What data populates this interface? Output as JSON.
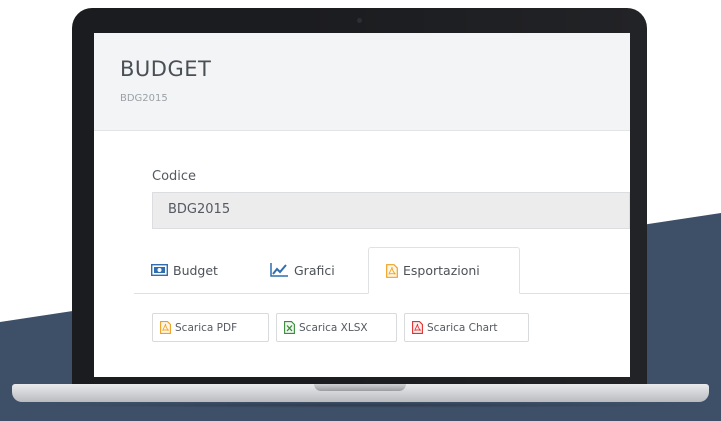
{
  "header": {
    "title": "BUDGET",
    "subtitle": "BDG2015"
  },
  "form": {
    "codice_label": "Codice",
    "codice_value": "BDG2015"
  },
  "tabs": [
    {
      "label": "Budget",
      "icon": "money-icon",
      "active": false
    },
    {
      "label": "Grafici",
      "icon": "line-chart-icon",
      "active": false
    },
    {
      "label": "Esportazioni",
      "icon": "file-pdf-icon",
      "active": true
    }
  ],
  "buttons": {
    "pdf": "Scarica PDF",
    "xlsx": "Scarica XLSX",
    "chart": "Scarica Chart"
  },
  "colors": {
    "band": "#3e5068",
    "pdf_orange": "#f0a020",
    "excel_green": "#3a8a3a",
    "pdf_red": "#e03030",
    "tab_icon_blue": "#2f6fb0"
  }
}
